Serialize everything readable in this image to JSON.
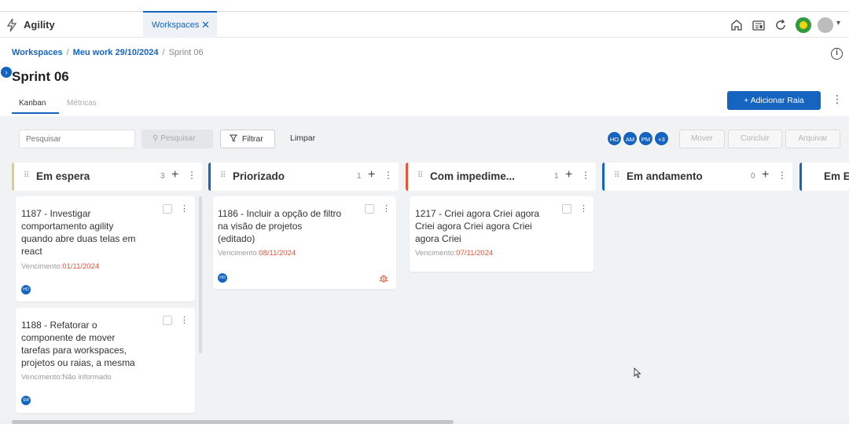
{
  "app": {
    "name": "Agility"
  },
  "tabs": [
    {
      "label": "Workspaces",
      "close": "✕"
    }
  ],
  "breadcrumb": {
    "items": [
      "Workspaces",
      "Meu work 29/10/2024",
      "Sprint 06"
    ]
  },
  "page": {
    "title": "Sprint 06"
  },
  "view_tabs": {
    "kanban": "Kanban",
    "metricas": "Métricas"
  },
  "actions": {
    "add_lane": "+ Adicionar Raia"
  },
  "toolbar": {
    "search_placeholder": "Pesquisar",
    "search_button": "Pesquisar",
    "filter": "Filtrar",
    "clear": "Limpar",
    "move": "Mover",
    "conclude": "Concluir",
    "archive": "Arquivar"
  },
  "members": [
    "HO",
    "AM",
    "PM",
    "+3"
  ],
  "columns": [
    {
      "title": "Em espera",
      "count": "3",
      "color": "#e8c98a"
    },
    {
      "title": "Priorizado",
      "count": "1",
      "color": "#1565c0"
    },
    {
      "title": "Com impedime...",
      "count": "1",
      "color": "#e0553b"
    },
    {
      "title": "Em andamento",
      "count": "0",
      "color": "#1565c0"
    },
    {
      "title": "Em E",
      "count": "",
      "color": "#1565c0"
    }
  ],
  "cards": [
    {
      "title_lines": [
        "1187 - Investigar",
        "comportamento agility",
        "quando abre duas telas em",
        "react"
      ],
      "due_label": "Vencimento:",
      "due_date": "01/11/2024",
      "avatar": "HO"
    },
    {
      "title_lines": [
        "1188 - Refatorar o",
        "componente de mover",
        "tarefas para workspaces,",
        "projetos ou raias, a mesma"
      ],
      "due_label": "Vencimento:",
      "due_date": "Não informado",
      "avatar": "SW"
    },
    {
      "title_lines": [
        "1186 - Incluir a opção de filtro",
        "na visão de projetos",
        "(editado)"
      ],
      "due_label": "Vencimento:",
      "due_date": "08/11/2024",
      "avatar": "HO"
    },
    {
      "title_lines": [
        "1217 - Criei agora Criei agora",
        "Criei agora Criei agora Criei",
        "agora Criei"
      ],
      "due_label": "Vencimento:",
      "due_date": "07/11/2024"
    }
  ],
  "colors": {
    "accent": "#1565c0",
    "due": "#e0553b",
    "board_bg": "#f1f2f4"
  },
  "icons": [
    "lightning-icon",
    "home-icon",
    "news-icon",
    "refresh-icon",
    "flag-icon",
    "user-icon",
    "info-icon",
    "filter-icon",
    "search-icon",
    "bug-icon",
    "drag-handle-icon"
  ]
}
